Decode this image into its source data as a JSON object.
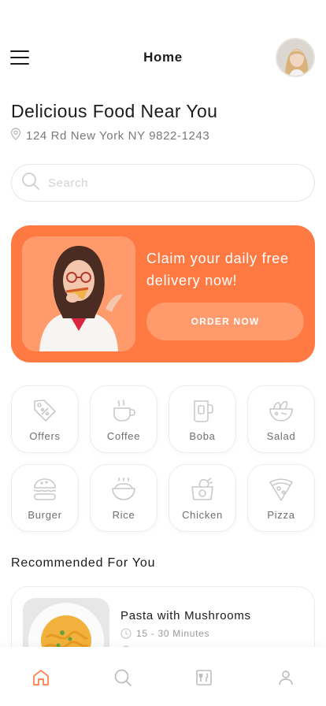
{
  "header": {
    "title": "Home",
    "menu_icon": "hamburger-menu-icon",
    "avatar_icon": "profile-avatar"
  },
  "hero": {
    "headline": "Delicious Food Near You",
    "location": "124 Rd New York NY 9822-1243",
    "location_icon": "map-pin-icon"
  },
  "search": {
    "placeholder": "Search",
    "icon": "search-icon"
  },
  "promo": {
    "text": "Claim your daily free delivery now!",
    "button_label": "ORDER NOW",
    "background_color": "#ff7a42",
    "button_color": "#ff9a6c"
  },
  "categories": [
    {
      "label": "Offers",
      "icon": "discount-tag-icon"
    },
    {
      "label": "Coffee",
      "icon": "coffee-cup-icon"
    },
    {
      "label": "Boba",
      "icon": "boba-cup-icon"
    },
    {
      "label": "Salad",
      "icon": "salad-bowl-icon"
    },
    {
      "label": "Burger",
      "icon": "burger-icon"
    },
    {
      "label": "Rice",
      "icon": "rice-bowl-icon"
    },
    {
      "label": "Chicken",
      "icon": "chicken-icon"
    },
    {
      "label": "Pizza",
      "icon": "pizza-slice-icon"
    }
  ],
  "recommended": {
    "title": "Recommended For You",
    "items": [
      {
        "name": "Pasta with Mushrooms",
        "time": "15 - 30 Minutes",
        "time_icon": "clock-icon"
      }
    ]
  },
  "tabbar": {
    "active": "home",
    "active_color": "#ff7a42",
    "tabs": [
      {
        "id": "home",
        "icon": "home-icon"
      },
      {
        "id": "search",
        "icon": "search-icon"
      },
      {
        "id": "menu",
        "icon": "menu-book-icon"
      },
      {
        "id": "profile",
        "icon": "user-icon"
      }
    ]
  }
}
